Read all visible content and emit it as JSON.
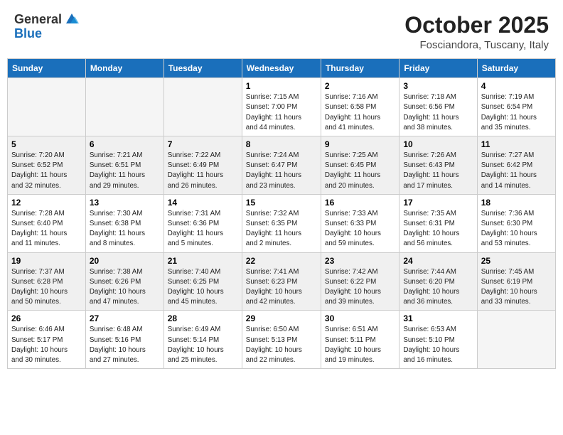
{
  "header": {
    "logo_general": "General",
    "logo_blue": "Blue",
    "month_title": "October 2025",
    "location": "Fosciandora, Tuscany, Italy"
  },
  "days_of_week": [
    "Sunday",
    "Monday",
    "Tuesday",
    "Wednesday",
    "Thursday",
    "Friday",
    "Saturday"
  ],
  "weeks": [
    [
      {
        "day": "",
        "info": ""
      },
      {
        "day": "",
        "info": ""
      },
      {
        "day": "",
        "info": ""
      },
      {
        "day": "1",
        "info": "Sunrise: 7:15 AM\nSunset: 7:00 PM\nDaylight: 11 hours\nand 44 minutes."
      },
      {
        "day": "2",
        "info": "Sunrise: 7:16 AM\nSunset: 6:58 PM\nDaylight: 11 hours\nand 41 minutes."
      },
      {
        "day": "3",
        "info": "Sunrise: 7:18 AM\nSunset: 6:56 PM\nDaylight: 11 hours\nand 38 minutes."
      },
      {
        "day": "4",
        "info": "Sunrise: 7:19 AM\nSunset: 6:54 PM\nDaylight: 11 hours\nand 35 minutes."
      }
    ],
    [
      {
        "day": "5",
        "info": "Sunrise: 7:20 AM\nSunset: 6:52 PM\nDaylight: 11 hours\nand 32 minutes."
      },
      {
        "day": "6",
        "info": "Sunrise: 7:21 AM\nSunset: 6:51 PM\nDaylight: 11 hours\nand 29 minutes."
      },
      {
        "day": "7",
        "info": "Sunrise: 7:22 AM\nSunset: 6:49 PM\nDaylight: 11 hours\nand 26 minutes."
      },
      {
        "day": "8",
        "info": "Sunrise: 7:24 AM\nSunset: 6:47 PM\nDaylight: 11 hours\nand 23 minutes."
      },
      {
        "day": "9",
        "info": "Sunrise: 7:25 AM\nSunset: 6:45 PM\nDaylight: 11 hours\nand 20 minutes."
      },
      {
        "day": "10",
        "info": "Sunrise: 7:26 AM\nSunset: 6:43 PM\nDaylight: 11 hours\nand 17 minutes."
      },
      {
        "day": "11",
        "info": "Sunrise: 7:27 AM\nSunset: 6:42 PM\nDaylight: 11 hours\nand 14 minutes."
      }
    ],
    [
      {
        "day": "12",
        "info": "Sunrise: 7:28 AM\nSunset: 6:40 PM\nDaylight: 11 hours\nand 11 minutes."
      },
      {
        "day": "13",
        "info": "Sunrise: 7:30 AM\nSunset: 6:38 PM\nDaylight: 11 hours\nand 8 minutes."
      },
      {
        "day": "14",
        "info": "Sunrise: 7:31 AM\nSunset: 6:36 PM\nDaylight: 11 hours\nand 5 minutes."
      },
      {
        "day": "15",
        "info": "Sunrise: 7:32 AM\nSunset: 6:35 PM\nDaylight: 11 hours\nand 2 minutes."
      },
      {
        "day": "16",
        "info": "Sunrise: 7:33 AM\nSunset: 6:33 PM\nDaylight: 10 hours\nand 59 minutes."
      },
      {
        "day": "17",
        "info": "Sunrise: 7:35 AM\nSunset: 6:31 PM\nDaylight: 10 hours\nand 56 minutes."
      },
      {
        "day": "18",
        "info": "Sunrise: 7:36 AM\nSunset: 6:30 PM\nDaylight: 10 hours\nand 53 minutes."
      }
    ],
    [
      {
        "day": "19",
        "info": "Sunrise: 7:37 AM\nSunset: 6:28 PM\nDaylight: 10 hours\nand 50 minutes."
      },
      {
        "day": "20",
        "info": "Sunrise: 7:38 AM\nSunset: 6:26 PM\nDaylight: 10 hours\nand 47 minutes."
      },
      {
        "day": "21",
        "info": "Sunrise: 7:40 AM\nSunset: 6:25 PM\nDaylight: 10 hours\nand 45 minutes."
      },
      {
        "day": "22",
        "info": "Sunrise: 7:41 AM\nSunset: 6:23 PM\nDaylight: 10 hours\nand 42 minutes."
      },
      {
        "day": "23",
        "info": "Sunrise: 7:42 AM\nSunset: 6:22 PM\nDaylight: 10 hours\nand 39 minutes."
      },
      {
        "day": "24",
        "info": "Sunrise: 7:44 AM\nSunset: 6:20 PM\nDaylight: 10 hours\nand 36 minutes."
      },
      {
        "day": "25",
        "info": "Sunrise: 7:45 AM\nSunset: 6:19 PM\nDaylight: 10 hours\nand 33 minutes."
      }
    ],
    [
      {
        "day": "26",
        "info": "Sunrise: 6:46 AM\nSunset: 5:17 PM\nDaylight: 10 hours\nand 30 minutes."
      },
      {
        "day": "27",
        "info": "Sunrise: 6:48 AM\nSunset: 5:16 PM\nDaylight: 10 hours\nand 27 minutes."
      },
      {
        "day": "28",
        "info": "Sunrise: 6:49 AM\nSunset: 5:14 PM\nDaylight: 10 hours\nand 25 minutes."
      },
      {
        "day": "29",
        "info": "Sunrise: 6:50 AM\nSunset: 5:13 PM\nDaylight: 10 hours\nand 22 minutes."
      },
      {
        "day": "30",
        "info": "Sunrise: 6:51 AM\nSunset: 5:11 PM\nDaylight: 10 hours\nand 19 minutes."
      },
      {
        "day": "31",
        "info": "Sunrise: 6:53 AM\nSunset: 5:10 PM\nDaylight: 10 hours\nand 16 minutes."
      },
      {
        "day": "",
        "info": ""
      }
    ]
  ]
}
